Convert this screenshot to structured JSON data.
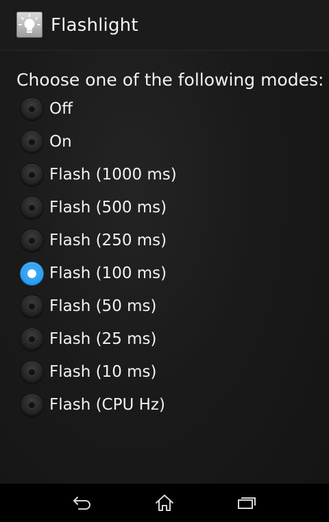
{
  "app": {
    "title": "Flashlight",
    "icon": "lightbulb-icon"
  },
  "prompt": "Choose one of the following modes:",
  "modes": [
    {
      "label": "Off",
      "selected": false
    },
    {
      "label": "On",
      "selected": false
    },
    {
      "label": "Flash (1000 ms)",
      "selected": false
    },
    {
      "label": "Flash (500 ms)",
      "selected": false
    },
    {
      "label": "Flash (250 ms)",
      "selected": false
    },
    {
      "label": "Flash (100 ms)",
      "selected": true
    },
    {
      "label": "Flash (50 ms)",
      "selected": false
    },
    {
      "label": "Flash (25 ms)",
      "selected": false
    },
    {
      "label": "Flash (10 ms)",
      "selected": false
    },
    {
      "label": "Flash (CPU Hz)",
      "selected": false
    }
  ],
  "navigation": {
    "buttons": [
      "back-icon",
      "home-icon",
      "recent-apps-icon"
    ]
  },
  "colors": {
    "accent": "#33a8ff",
    "background": "#1a1a1a",
    "text": "#f2f2f2"
  }
}
